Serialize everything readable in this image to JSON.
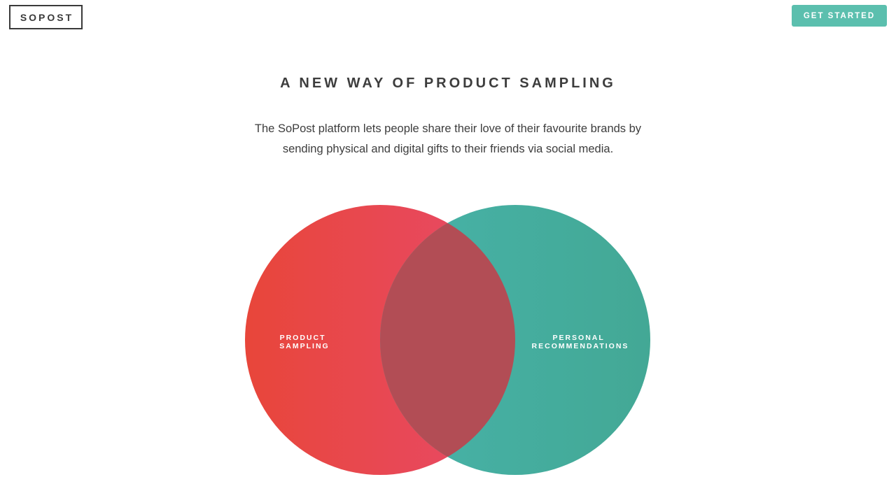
{
  "header": {
    "logo_text": "SOPOST",
    "cta_label": "GET STARTED"
  },
  "hero": {
    "title": "A NEW WAY OF PRODUCT SAMPLING",
    "description_line1": "The SoPost platform lets people share their love of their favourite brands by",
    "description_line2": "sending physical and digital gifts to their friends via social media."
  },
  "venn": {
    "left": {
      "label_line1": "PRODUCT",
      "label_line2": "SAMPLING"
    },
    "right": {
      "label_line1": "PERSONAL",
      "label_line2": "RECOMMENDATIONS"
    }
  },
  "colors": {
    "accent": "#5bbfae",
    "left_circle_start": "#e8463a",
    "left_circle_end": "#e84a68",
    "right_circle_start": "#45b2a8",
    "right_circle_end": "#44a893",
    "overlap": "#b24d55",
    "text": "#3d3d3d"
  }
}
